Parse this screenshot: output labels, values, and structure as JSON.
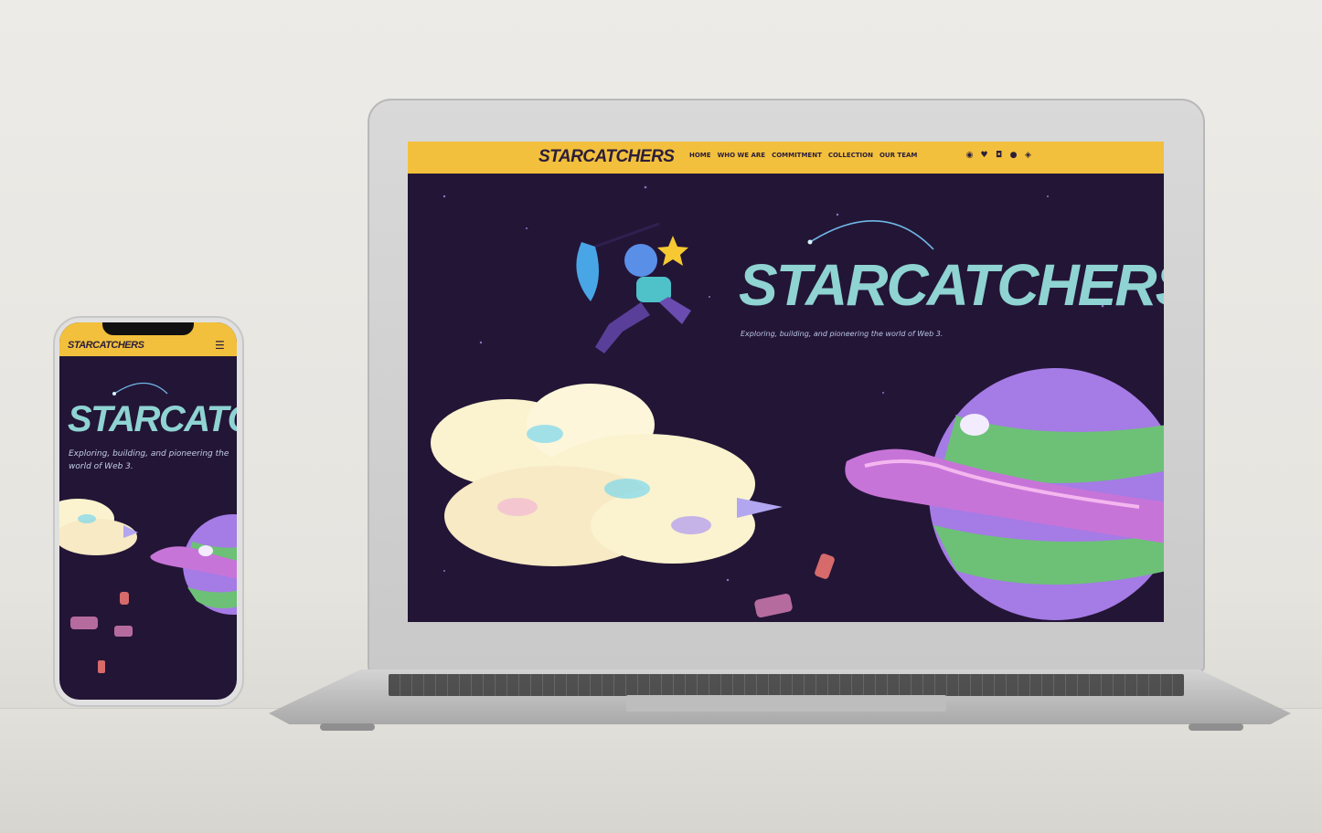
{
  "laptop_site": {
    "logo": "STARCATCHERS",
    "nav": [
      "HOME",
      "WHO WE ARE",
      "COMMITMENT",
      "COLLECTION",
      "OUR TEAM"
    ],
    "socials": [
      "discord-icon",
      "twitter-icon",
      "instagram-icon",
      "opensea-icon",
      "diamond-icon"
    ],
    "hero_title": "STARCATCHERS",
    "tagline": "Exploring, building, and pioneering the world of Web 3."
  },
  "phone_site": {
    "logo": "STARCATCHERS",
    "menu_icon": "hamburger-icon",
    "hero_title": "STARCATCHERS",
    "tagline": "Exploring, building, and pioneering the world of Web 3."
  },
  "colors": {
    "nav_yellow": "#f2c03c",
    "space_bg": "#231536",
    "title_teal": "#8fd3d3",
    "planet_purple": "#a57be6",
    "planet_green": "#6cc177",
    "cloud_cream": "#fbf3cf"
  }
}
